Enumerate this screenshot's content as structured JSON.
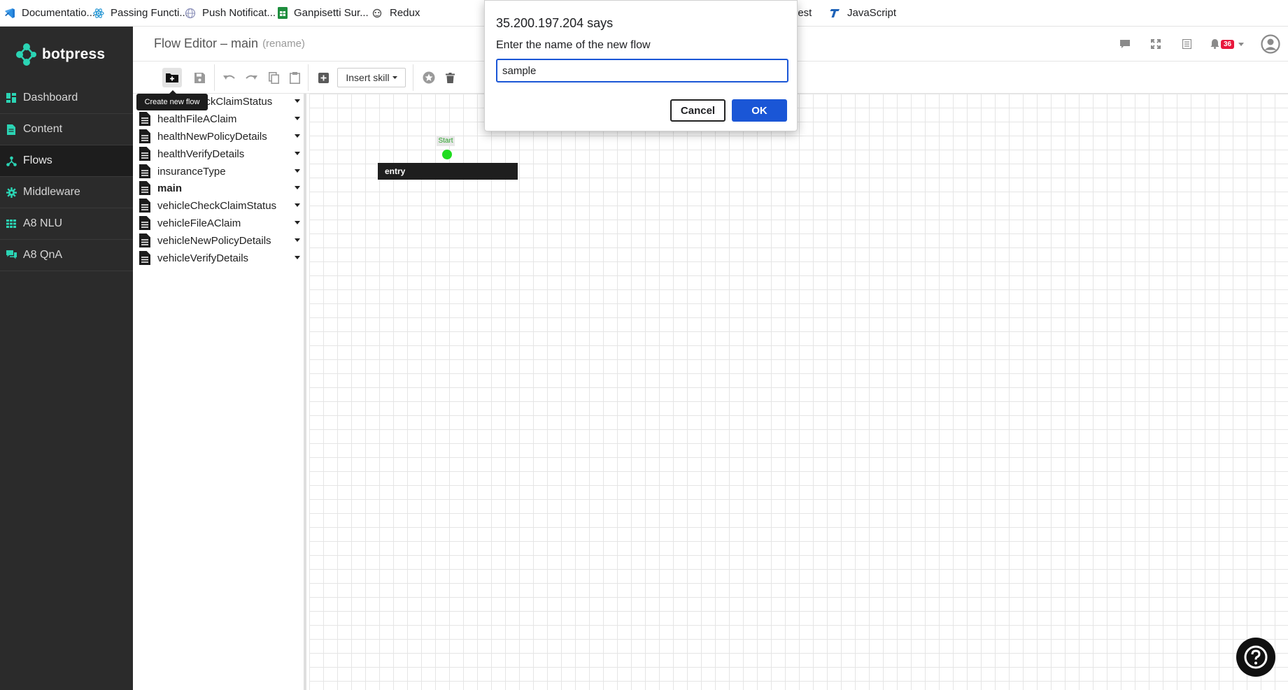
{
  "bookmarks": [
    {
      "label": "Documentatio...",
      "icon": "vscode-icon",
      "color": "#1f78d1"
    },
    {
      "label": "Passing Functi...",
      "icon": "react-icon",
      "color": "#2f9bd6"
    },
    {
      "label": "Push Notificat...",
      "icon": "globe-icon",
      "color": "#8a8fb8"
    },
    {
      "label": "Ganpisetti Sur...",
      "icon": "sheets-icon",
      "color": "#1e8e3e"
    },
    {
      "label": "Redux",
      "icon": "redux-icon",
      "color": "#555555"
    },
    {
      "label": "erest",
      "icon": "",
      "color": ""
    },
    {
      "label": "JavaScript",
      "icon": "typescript-icon",
      "color": "#1e63b8"
    }
  ],
  "brand": {
    "name": "botpress",
    "accent": "#2bd4b4"
  },
  "sidebar": {
    "items": [
      {
        "label": "Dashboard",
        "icon": "dashboard-icon"
      },
      {
        "label": "Content",
        "icon": "content-icon"
      },
      {
        "label": "Flows",
        "icon": "flows-icon",
        "active": true
      },
      {
        "label": "Middleware",
        "icon": "gear-icon"
      },
      {
        "label": "A8 NLU",
        "icon": "nlu-icon"
      },
      {
        "label": "A8 QnA",
        "icon": "qna-icon"
      }
    ]
  },
  "header": {
    "title": "Flow Editor – main",
    "rename": "(rename)",
    "notification_count": "36"
  },
  "toolbar": {
    "insert_skill": "Insert skill",
    "tooltip": "Create new flow"
  },
  "flows": [
    {
      "name": "healthCheckClaimStatus"
    },
    {
      "name": "healthFileAClaim"
    },
    {
      "name": "healthNewPolicyDetails"
    },
    {
      "name": "healthVerifyDetails"
    },
    {
      "name": "insuranceType"
    },
    {
      "name": "main",
      "current": true
    },
    {
      "name": "vehicleCheckClaimStatus"
    },
    {
      "name": "vehicleFileAClaim"
    },
    {
      "name": "vehicleNewPolicyDetails"
    },
    {
      "name": "vehicleVerifyDetails"
    }
  ],
  "canvas": {
    "start_label": "Start",
    "node_label": "entry"
  },
  "dialog": {
    "title": "35.200.197.204 says",
    "message": "Enter the name of the new flow",
    "input_value": "sample",
    "cancel_label": "Cancel",
    "ok_label": "OK"
  }
}
